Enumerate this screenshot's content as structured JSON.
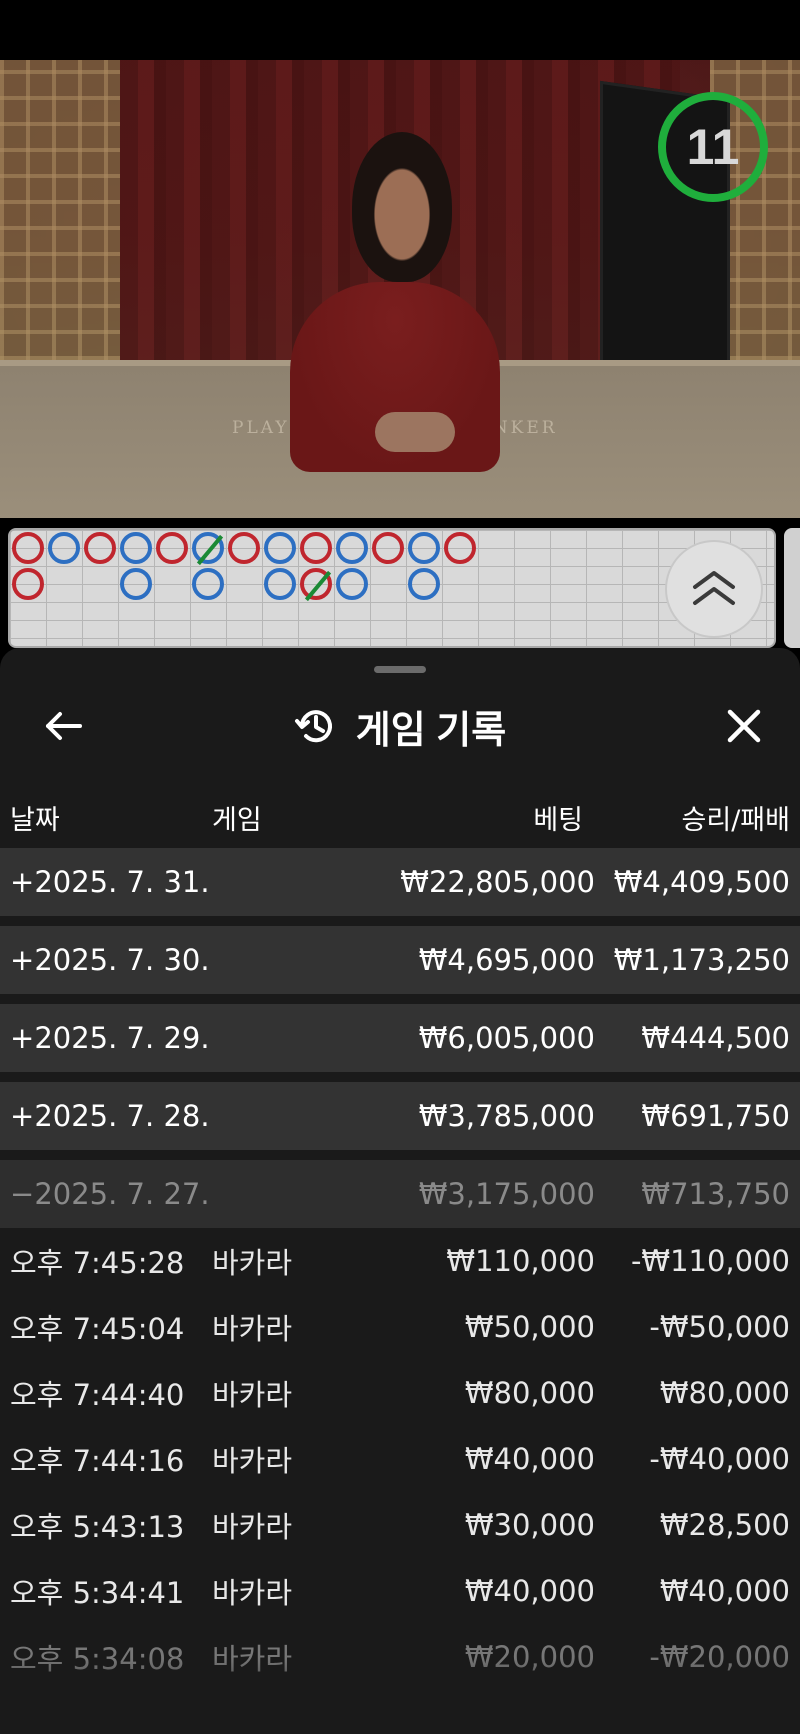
{
  "video": {
    "table_labels": [
      "PLAYER",
      "BANKER"
    ],
    "timer_value": "11",
    "timer_color": "#1fae3c"
  },
  "road": {
    "red_color": "#c0262e",
    "blue_color": "#2d6fc2",
    "tie_color": "#1b8a35",
    "top_row": [
      "red",
      "blue",
      "red",
      "blue",
      "red",
      "blue-tie",
      "red",
      "blue",
      "red",
      "blue",
      "red",
      "blue",
      "red"
    ],
    "bottom_row": [
      "red",
      null,
      null,
      "blue",
      null,
      "blue",
      null,
      "blue",
      "red-tie",
      "blue",
      null,
      "blue",
      null
    ]
  },
  "sheet": {
    "title": "게임 기록",
    "back_icon": "arrow-left-icon",
    "history_icon": "history-icon",
    "close_icon": "close-icon",
    "columns": {
      "date": "날짜",
      "game": "게임",
      "bet": "베팅",
      "win_loss": "승리/패배"
    },
    "days": [
      {
        "sign": "+",
        "date": "2025. 7. 31.",
        "bet": "₩22,805,000",
        "win": "₩4,409,500"
      },
      {
        "sign": "+",
        "date": "2025. 7. 30.",
        "bet": "₩4,695,000",
        "win": "₩1,173,250"
      },
      {
        "sign": "+",
        "date": "2025. 7. 29.",
        "bet": "₩6,005,000",
        "win": "₩444,500"
      },
      {
        "sign": "+",
        "date": "2025. 7. 28.",
        "bet": "₩3,785,000",
        "win": "₩691,750"
      }
    ],
    "expanded_day": {
      "sign": "−",
      "date": "2025. 7. 27.",
      "bet": "₩3,175,000",
      "win": "₩713,750"
    },
    "games": [
      {
        "time": "오후 7:45:28",
        "game": "바카라",
        "bet": "₩110,000",
        "win": "-₩110,000"
      },
      {
        "time": "오후 7:45:04",
        "game": "바카라",
        "bet": "₩50,000",
        "win": "-₩50,000"
      },
      {
        "time": "오후 7:44:40",
        "game": "바카라",
        "bet": "₩80,000",
        "win": "₩80,000"
      },
      {
        "time": "오후 7:44:16",
        "game": "바카라",
        "bet": "₩40,000",
        "win": "-₩40,000"
      },
      {
        "time": "오후 5:43:13",
        "game": "바카라",
        "bet": "₩30,000",
        "win": "₩28,500"
      },
      {
        "time": "오후 5:34:41",
        "game": "바카라",
        "bet": "₩40,000",
        "win": "₩40,000"
      },
      {
        "time": "오후 5:34:08",
        "game": "바카라",
        "bet": "₩20,000",
        "win": "-₩20,000"
      }
    ]
  }
}
